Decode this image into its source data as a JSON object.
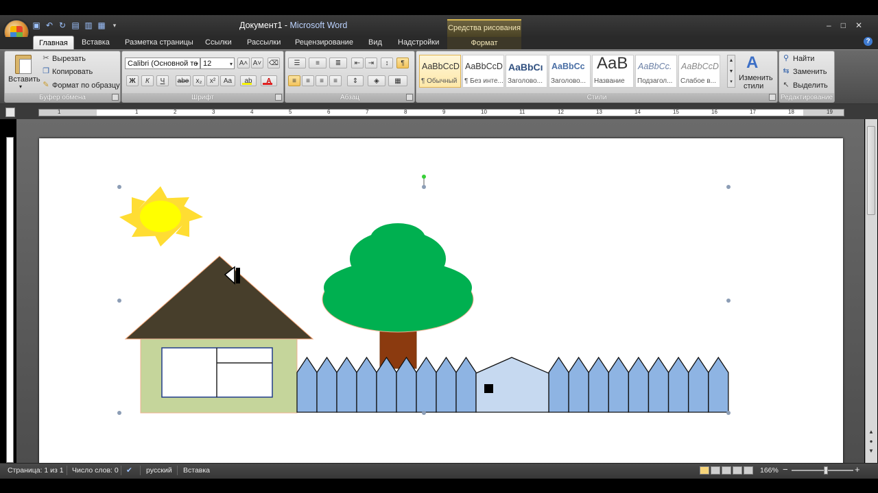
{
  "window": {
    "doc_name": "Документ1",
    "sep": " - ",
    "app_name": "Microsoft Word",
    "context_tool": "Средства рисования",
    "controls": [
      "–",
      "□",
      "✕"
    ]
  },
  "qat": [
    "save-icon",
    "undo-icon",
    "redo-icon"
  ],
  "tabs": {
    "home": "Главная",
    "insert": "Вставка",
    "layout": "Разметка страницы",
    "refs": "Ссылки",
    "mail": "Рассылки",
    "review": "Рецензирование",
    "view": "Вид",
    "addins": "Надстройки",
    "format": "Формат"
  },
  "clipboard": {
    "paste": "Вставить",
    "cut": "Вырезать",
    "copy": "Копировать",
    "painter": "Формат по образцу",
    "label": "Буфер обмена"
  },
  "font": {
    "name": "Calibri (Основной те",
    "size": "12",
    "label": "Шрифт",
    "bold": "Ж",
    "italic": "К",
    "underline": "Ч",
    "strike": "abe",
    "sub": "x₂",
    "sup": "x²",
    "case": "Aa",
    "grow": "A˄",
    "shrink": "A˅",
    "color_letter": "A",
    "color_bar": "#e02020",
    "highlight_bar": "#f4f000"
  },
  "paragraph": {
    "label": "Абзац",
    "pilcrow": "¶"
  },
  "styles": {
    "label": "Стили",
    "items": [
      {
        "sample": "AaBbCcD",
        "name": "¶ Обычный"
      },
      {
        "sample": "AaBbCcD",
        "name": "¶ Без инте..."
      },
      {
        "sample": "AaBbCı",
        "name": "Заголово..."
      },
      {
        "sample": "AaBbCc",
        "name": "Заголово..."
      },
      {
        "sample": "AaB",
        "name": "Название"
      },
      {
        "sample": "AaBbCc.",
        "name": "Подзагол..."
      },
      {
        "sample": "AaBbCcD",
        "name": "Слабое в..."
      }
    ],
    "change": "Изменить",
    "change2": "стили"
  },
  "editing": {
    "find": "Найти",
    "replace": "Заменить",
    "select": "Выделить",
    "label": "Редактирование"
  },
  "ruler": {
    "numbers": [
      "1",
      "1",
      "2",
      "3",
      "4",
      "5",
      "6",
      "7",
      "8",
      "9",
      "10",
      "11",
      "12",
      "13",
      "14",
      "15",
      "16",
      "17",
      "18",
      "19"
    ]
  },
  "status": {
    "page": "Страница: 1 из 1",
    "words": "Число слов: 0",
    "lang": "русский",
    "mode": "Вставка",
    "zoom": "166%",
    "zoom_minus": "−",
    "zoom_plus": "+"
  },
  "colors": {
    "sun": "#ffff00",
    "sun_rays": "#ffdd33",
    "roof": "#473e2b",
    "house_wall": "#c5d59b",
    "tree_crown": "#00b050",
    "tree_trunk": "#8b3a0f",
    "fence": "#8eb4e3",
    "gate": "#c6d9f0",
    "selection_handle": "#8c9db5",
    "rotate_handle": "#37d037"
  }
}
